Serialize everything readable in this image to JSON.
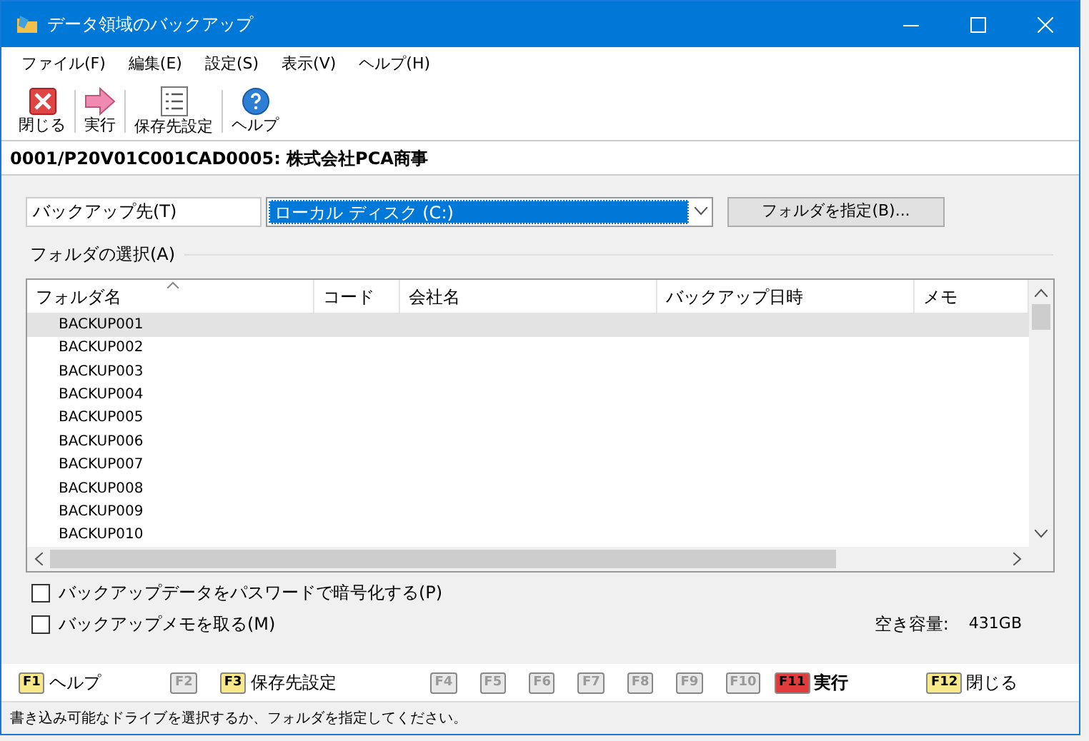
{
  "window": {
    "title": "データ領域のバックアップ"
  },
  "menu": [
    "ファイル(F)",
    "編集(E)",
    "設定(S)",
    "表示(V)",
    "ヘルプ(H)"
  ],
  "toolbar": [
    {
      "kind": "close",
      "label": "閉じる"
    },
    {
      "kind": "run",
      "label": "実行"
    },
    {
      "kind": "settings",
      "label": "保存先設定"
    },
    {
      "kind": "help",
      "label": "ヘルプ"
    }
  ],
  "header": "0001/P20V01C001CAD0005: 株式会社PCA商事",
  "destination": {
    "label": "バックアップ先(T)",
    "value": "ローカル ディスク (C:)",
    "button": "フォルダを指定(B)..."
  },
  "folder_section": "フォルダの選択(A)",
  "table": {
    "columns": [
      "フォルダ名",
      "コード",
      "会社名",
      "バックアップ日時",
      "メモ"
    ],
    "rows": [
      {
        "folder": "BACKUP001",
        "selected": true
      },
      {
        "folder": "BACKUP002",
        "selected": false
      },
      {
        "folder": "BACKUP003",
        "selected": false
      },
      {
        "folder": "BACKUP004",
        "selected": false
      },
      {
        "folder": "BACKUP005",
        "selected": false
      },
      {
        "folder": "BACKUP006",
        "selected": false
      },
      {
        "folder": "BACKUP007",
        "selected": false
      },
      {
        "folder": "BACKUP008",
        "selected": false
      },
      {
        "folder": "BACKUP009",
        "selected": false
      },
      {
        "folder": "BACKUP010",
        "selected": false
      }
    ]
  },
  "options": [
    {
      "label": "バックアップデータをパスワードで暗号化する(P)",
      "checked": false
    },
    {
      "label": "バックアップメモを取る(M)",
      "checked": false
    }
  ],
  "free_space": {
    "label": "空き容量:",
    "value": "431GB"
  },
  "function_keys": [
    {
      "key": "F1",
      "label": "ヘルプ",
      "color": "#f7e98a"
    },
    {
      "key": "F2",
      "color": "#e8e8e8"
    },
    {
      "key": "F3",
      "label": "保存先設定",
      "color": "#f7e98a"
    },
    {
      "key": "F4",
      "color": "#e8e8e8"
    },
    {
      "key": "F5",
      "color": "#e8e8e8"
    },
    {
      "key": "F6",
      "color": "#e8e8e8"
    },
    {
      "key": "F7",
      "color": "#e8e8e8"
    },
    {
      "key": "F8",
      "color": "#e8e8e8"
    },
    {
      "key": "F9",
      "color": "#e8e8e8"
    },
    {
      "key": "F10",
      "color": "#e8e8e8"
    },
    {
      "key": "F11",
      "label": "実行",
      "color": "#e23b3b"
    },
    {
      "key": "F12",
      "label": "閉じる",
      "color": "#f7e98a"
    }
  ],
  "status_bar": "書き込み可能なドライブを選択するか、フォルダを指定してください。"
}
